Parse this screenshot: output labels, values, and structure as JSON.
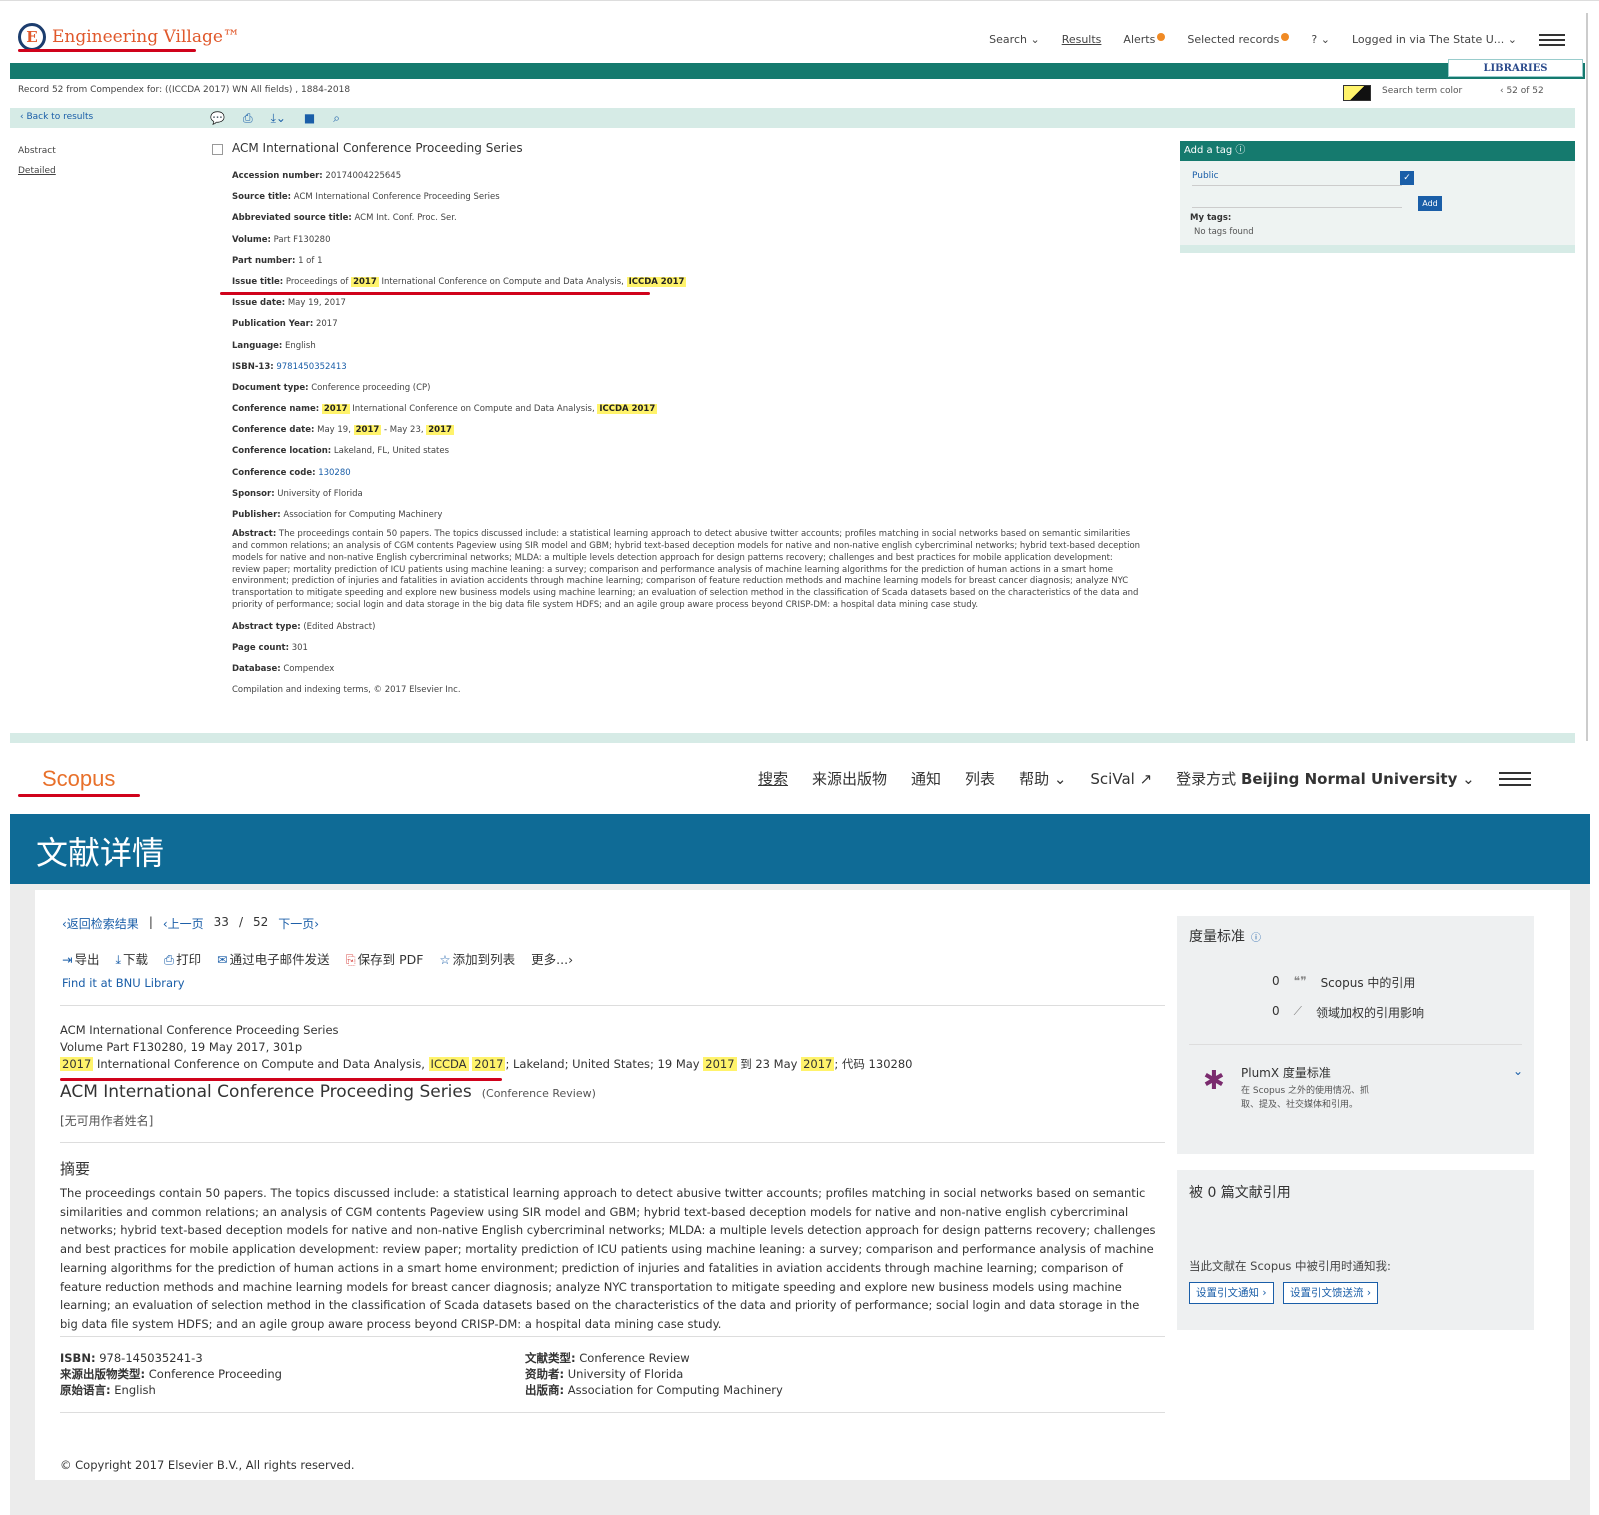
{
  "ev": {
    "logo_mark": "E",
    "logo_text": "Engineering Village™",
    "nav": {
      "search": "Search ⌄",
      "results": "Results",
      "alerts": "Alerts",
      "selected": "Selected records",
      "help": "? ⌄",
      "login": "Logged in via The State U... ⌄"
    },
    "libraries": "LIBRARIES",
    "record_line": "Record 52 from Compendex for: ((ICCDA 2017) WN All fields) , 1884-2018",
    "search_term_color": "Search term color",
    "pager": "‹  52 of 52",
    "back": "‹ Back to results",
    "side_abstract": "Abstract",
    "side_detailed": "Detailed",
    "title": "ACM International Conference Proceeding Series",
    "fields": {
      "accession_k": "Accession number:",
      "accession_v": "20174004225645",
      "source_k": "Source title:",
      "source_v": "ACM International Conference Proceeding Series",
      "abbr_k": "Abbreviated source title:",
      "abbr_v": "ACM Int. Conf. Proc. Ser.",
      "volume_k": "Volume:",
      "volume_v": "Part F130280",
      "part_k": "Part number:",
      "part_v": "1 of 1",
      "issue_k": "Issue title:",
      "issue_v1": "Proceedings of",
      "issue_y": "2017",
      "issue_v2": "International Conference on Compute and Data Analysis,",
      "issue_c": "ICCDA 2017",
      "idate_k": "Issue date:",
      "idate_v": "May 19, 2017",
      "pubyear_k": "Publication Year:",
      "pubyear_v": "2017",
      "lang_k": "Language:",
      "lang_v": "English",
      "isbn_k": "ISBN-13:",
      "isbn_v": "9781450352413",
      "doctype_k": "Document type:",
      "doctype_v": "Conference proceeding (CP)",
      "confname_k": "Conference name:",
      "confname_y": "2017",
      "confname_v": "International Conference on Compute and Data Analysis,",
      "confname_c": "ICCDA 2017",
      "confdate_k": "Conference date:",
      "confdate_v1": "May 19,",
      "confdate_y1": "2017",
      "confdate_v2": "- May 23,",
      "confdate_y2": "2017",
      "confloc_k": "Conference location:",
      "confloc_v": "Lakeland, FL, United states",
      "confcode_k": "Conference code:",
      "confcode_v": "130280",
      "sponsor_k": "Sponsor:",
      "sponsor_v": "University of Florida",
      "publisher_k": "Publisher:",
      "publisher_v": "Association for Computing Machinery",
      "abstract_k": "Abstract:",
      "abstract_v": "The proceedings contain 50 papers. The topics discussed include: a statistical learning approach to detect abusive twitter accounts; profiles matching in social networks based on semantic similarities and common relations; an analysis of CGM contents Pageview using SIR model and GBM; hybrid text-based deception models for native and non-native english cybercriminal networks; hybrid text-based deception models for native and non-native English cybercriminal networks; MLDA: a multiple levels detection approach for design patterns recovery; challenges and best practices for mobile application development: review paper; mortality prediction of ICU patients using machine leaning: a survey; comparison and performance analysis of machine learning algorithms for the prediction of human actions in a smart home environment; prediction of injuries and fatalities in aviation accidents through machine learning; comparison of feature reduction methods and machine learning models for breast cancer diagnosis; analyze NYC transportation to mitigate speeding and explore new business models using machine learning; an evaluation of selection method in the classification of Scada datasets based on the characteristics of the data and priority of performance; social login and data storage in the big data file system HDFS; and an agile group aware process beyond CRISP-DM: a hospital data mining case study.",
      "abstype_k": "Abstract type:",
      "abstype_v": "(Edited Abstract)",
      "pages_k": "Page count:",
      "pages_v": "301",
      "db_k": "Database:",
      "db_v": "Compendex",
      "copyright": "Compilation and indexing terms, © 2017 Elsevier Inc."
    },
    "tag": {
      "head": "Add a tag ⓘ",
      "public": "Public",
      "add": "Add",
      "mytags": "My tags:",
      "notags": "No tags found"
    }
  },
  "sc": {
    "logo": "Scopus",
    "nav": {
      "search": "搜索",
      "sources": "来源出版物",
      "alerts": "通知",
      "lists": "列表",
      "help": "帮助 ⌄",
      "scival": "SciVal ↗",
      "login_prefix": "登录方式",
      "login_inst": "Beijing Normal University",
      "login_chev": "⌄"
    },
    "banner": "文献详情",
    "crumbs": {
      "back": "‹返回检索结果",
      "prev": "‹上一页",
      "pos": "33",
      "sep": "/",
      "total": "52",
      "next": "下一页›"
    },
    "actions": {
      "export": "导出",
      "download": "下载",
      "print": "打印",
      "email": "通过电子邮件发送",
      "pdf": "保存到 PDF",
      "addlist": "添加到列表",
      "more": "更多...›"
    },
    "findit": "Find it at BNU Library",
    "source_line1": "ACM International Conference Proceeding Series",
    "source_line2": "Volume Part F130280, 19 May 2017, 301p",
    "conf": {
      "y1": "2017",
      "t1": "International Conference on Compute and Data Analysis,",
      "c1": "ICCDA",
      "y2": "2017",
      "t2": "; Lakeland; United States; 19 May",
      "y3": "2017",
      "t3": "到 23 May",
      "y4": "2017",
      "t4": "; 代码 130280"
    },
    "doc_title": "ACM International Conference Proceeding Series",
    "doc_type_paren": "(Conference Review)",
    "noauthor": "[无可用作者姓名]",
    "abstract_head": "摘要",
    "abstract": "The proceedings contain 50 papers. The topics discussed include: a statistical learning approach to detect abusive twitter accounts; profiles matching in social networks based on semantic similarities and common relations; an analysis of CGM contents Pageview using SIR model and GBM; hybrid text-based deception models for native and non-native english cybercriminal networks; hybrid text-based deception models for native and non-native English cybercriminal networks; MLDA: a multiple levels detection approach for design patterns recovery; challenges and best practices for mobile application development: review paper; mortality prediction of ICU patients using machine leaning: a survey; comparison and performance analysis of machine learning algorithms for the prediction of human actions in a smart home environment; prediction of injuries and fatalities in aviation accidents through machine learning; comparison of feature reduction methods and machine learning models for breast cancer diagnosis; analyze NYC transportation to mitigate speeding and explore new business models using machine learning; an evaluation of selection method in the classification of Scada datasets based on the characteristics of the data and priority of performance; social login and data storage in the big data file system HDFS; and an agile group aware process beyond CRISP-DM: a hospital data mining case study.",
    "meta": {
      "isbn_k": "ISBN:",
      "isbn_v": "978-145035241-3",
      "srctype_k": "来源出版物类型:",
      "srctype_v": "Conference Proceeding",
      "lang_k": "原始语言:",
      "lang_v": "English",
      "doctype_k": "文献类型:",
      "doctype_v": "Conference Review",
      "sponsor_k": "资助者:",
      "sponsor_v": "University of Florida",
      "publisher_k": "出版商:",
      "publisher_v": "Association for Computing Machinery"
    },
    "copyright": "© Copyright 2017 Elsevier B.V., All rights reserved.",
    "metrics": {
      "title": "度量标准",
      "help": "ⓘ",
      "cit_count": "0",
      "cit_icon": "❝❞",
      "cit_label": "Scopus 中的引用",
      "fwci_count": "0",
      "fwci_icon": "⟋",
      "fwci_label": "领域加权的引用影响",
      "plumx_icon": "✱",
      "plumx_title": "PlumX 度量标准",
      "plumx_desc": "在 Scopus 之外的使用情况、抓取、提及、社交媒体和引用。",
      "chev": "⌄"
    },
    "citedby": {
      "title": "被 0 篇文献引用",
      "notify": "当此文献在 Scopus 中被引用时通知我:",
      "btn_alert": "设置引文通知 ›",
      "btn_feed": "设置引文馈送流 ›"
    }
  },
  "colors": {
    "ev_green": "#157a6e",
    "ev_orange": "#e0582b",
    "scopus_orange": "#e8702a",
    "scopus_blue": "#0f6b96",
    "highlight": "#fff36b",
    "annotation_red": "#d0021b"
  }
}
